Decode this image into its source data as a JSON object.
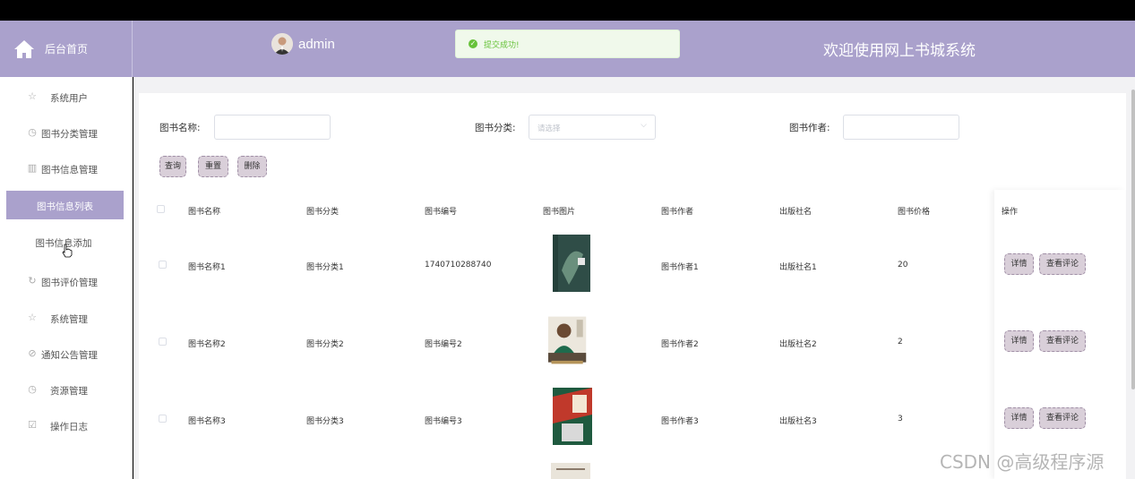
{
  "header": {
    "brand_label": "后台首页",
    "user_name": "admin",
    "toast_message": "提交成功!",
    "welcome": "欢迎使用网上书城系统",
    "bg_color": "#aaa1cc"
  },
  "sidebar": {
    "items": [
      {
        "label": "系统用户",
        "icon": "star-icon"
      },
      {
        "label": "图书分类管理",
        "icon": "clock-icon"
      },
      {
        "label": "图书信息管理",
        "icon": "trash-icon"
      },
      {
        "label": "图书信息列表",
        "icon": "none"
      },
      {
        "label": "图书信息添加",
        "icon": "none"
      },
      {
        "label": "图书评价管理",
        "icon": "refresh-icon"
      },
      {
        "label": "系统管理",
        "icon": "star-icon"
      },
      {
        "label": "通知公告管理",
        "icon": "compass-icon"
      },
      {
        "label": "资源管理",
        "icon": "clock-icon"
      },
      {
        "label": "操作日志",
        "icon": "calendar-check-icon"
      }
    ]
  },
  "search": {
    "name_label": "图书名称:",
    "category_label": "图书分类:",
    "category_placeholder": "请选择",
    "author_label": "图书作者:",
    "query_btn": "查询",
    "reset_btn": "重置",
    "delete_btn": "删除"
  },
  "table": {
    "headers": [
      "图书名称",
      "图书分类",
      "图书编号",
      "图书图片",
      "图书作者",
      "出版社名",
      "图书价格",
      "操作"
    ],
    "rows": [
      {
        "name": "图书名称1",
        "category": "图书分类1",
        "code": "1740710288740",
        "author": "图书作者1",
        "publisher": "出版社名1",
        "price": "20"
      },
      {
        "name": "图书名称2",
        "category": "图书分类2",
        "code": "图书编号2",
        "author": "图书作者2",
        "publisher": "出版社名2",
        "price": "2"
      },
      {
        "name": "图书名称3",
        "category": "图书分类3",
        "code": "图书编号3",
        "author": "图书作者3",
        "publisher": "出版社名3",
        "price": "3"
      }
    ],
    "detail_btn": "详情",
    "review_btn": "查看评论"
  },
  "watermark": "CSDN @高级程序源"
}
